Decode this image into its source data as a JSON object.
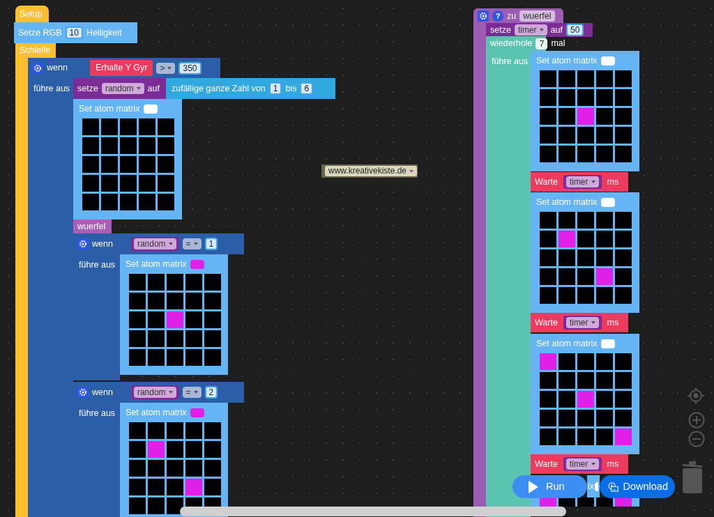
{
  "canvas": {
    "setup": {
      "label": "Setup"
    },
    "set_rgb": {
      "label": "Setze RGB",
      "value": "10",
      "suffix": "Helligkeit"
    },
    "loop": {
      "label": "Schleife"
    },
    "if_gyro": {
      "keyword": "wenn",
      "sensor": "Erhalte Y Gyr",
      "operator": ">",
      "value": "350",
      "do_label": "führe aus"
    },
    "set_random": {
      "label": "setze",
      "variable": "random",
      "to_label": "auf",
      "random_label": "zufällige ganze Zahl von",
      "from": "1",
      "to_word": "bis",
      "to": "6"
    },
    "call_block": {
      "label": "wuerfel"
    },
    "if_random": [
      {
        "keyword": "wenn",
        "variable": "random",
        "operator": "=",
        "value": "1",
        "do_label": "führe aus"
      },
      {
        "keyword": "wenn",
        "variable": "random",
        "operator": "=",
        "value": "2",
        "do_label": "führe aus"
      }
    ],
    "procedure": {
      "keyword": "zu",
      "name": "wuerfel",
      "help": "?"
    },
    "set_timer": {
      "label": "setze",
      "variable": "timer",
      "to_label": "auf",
      "value": "50"
    },
    "repeat": {
      "label": "wiederhole",
      "count": "7",
      "suffix": "mal",
      "do_label": "führe aus"
    },
    "wait_blocks": [
      {
        "label": "Warte",
        "variable": "timer",
        "unit": "ms"
      },
      {
        "label": "Warte",
        "variable": "timer",
        "unit": "ms"
      },
      {
        "label": "Warte",
        "variable": "timer",
        "unit": "ms"
      }
    ],
    "matrix_blocks": [
      {
        "label": "Set atom matrix",
        "color": "#ffffff",
        "rows": [
          [
            false,
            false,
            false,
            false,
            false
          ],
          [
            false,
            false,
            false,
            false,
            false
          ],
          [
            false,
            false,
            false,
            false,
            false
          ],
          [
            false,
            false,
            false,
            false,
            false
          ],
          [
            false,
            false,
            false,
            false,
            false
          ]
        ]
      },
      {
        "label": "Set atom matrix",
        "color": "#e020e8",
        "rows": [
          [
            false,
            false,
            false,
            false,
            false
          ],
          [
            false,
            false,
            false,
            false,
            false
          ],
          [
            false,
            false,
            true,
            false,
            false
          ],
          [
            false,
            false,
            false,
            false,
            false
          ],
          [
            false,
            false,
            false,
            false,
            false
          ]
        ]
      },
      {
        "label": "Set atom matrix",
        "color": "#e020e8",
        "rows": [
          [
            false,
            false,
            false,
            false,
            false
          ],
          [
            false,
            true,
            false,
            false,
            false
          ],
          [
            false,
            false,
            false,
            false,
            false
          ],
          [
            false,
            false,
            false,
            true,
            false
          ],
          [
            false,
            false,
            false,
            false,
            false
          ]
        ]
      },
      {
        "label": "Set atom matrix",
        "color": "#ffffff",
        "rows": [
          [
            false,
            false,
            false,
            false,
            false
          ],
          [
            false,
            false,
            false,
            false,
            false
          ],
          [
            false,
            false,
            true,
            false,
            false
          ],
          [
            false,
            false,
            false,
            false,
            false
          ],
          [
            false,
            false,
            false,
            false,
            false
          ]
        ]
      },
      {
        "label": "Set atom matrix",
        "color": "#ffffff",
        "rows": [
          [
            false,
            false,
            false,
            false,
            false
          ],
          [
            false,
            true,
            false,
            false,
            false
          ],
          [
            false,
            false,
            false,
            false,
            false
          ],
          [
            false,
            false,
            false,
            true,
            false
          ],
          [
            false,
            false,
            false,
            false,
            false
          ]
        ]
      },
      {
        "label": "Set atom matrix",
        "color": "#ffffff",
        "rows": [
          [
            true,
            false,
            false,
            false,
            false
          ],
          [
            false,
            false,
            false,
            false,
            false
          ],
          [
            false,
            false,
            true,
            false,
            false
          ],
          [
            false,
            false,
            false,
            false,
            false
          ],
          [
            false,
            false,
            false,
            false,
            true
          ]
        ]
      },
      {
        "label": "ix",
        "color": "#ffffff",
        "rows": [
          [
            true,
            false,
            false,
            false,
            true
          ]
        ]
      }
    ],
    "url_block": {
      "value": "www.kreativekiste.de"
    }
  },
  "buttons": [
    {
      "label": "Run",
      "kind": "run"
    },
    {
      "label": "Download",
      "kind": "download"
    }
  ]
}
